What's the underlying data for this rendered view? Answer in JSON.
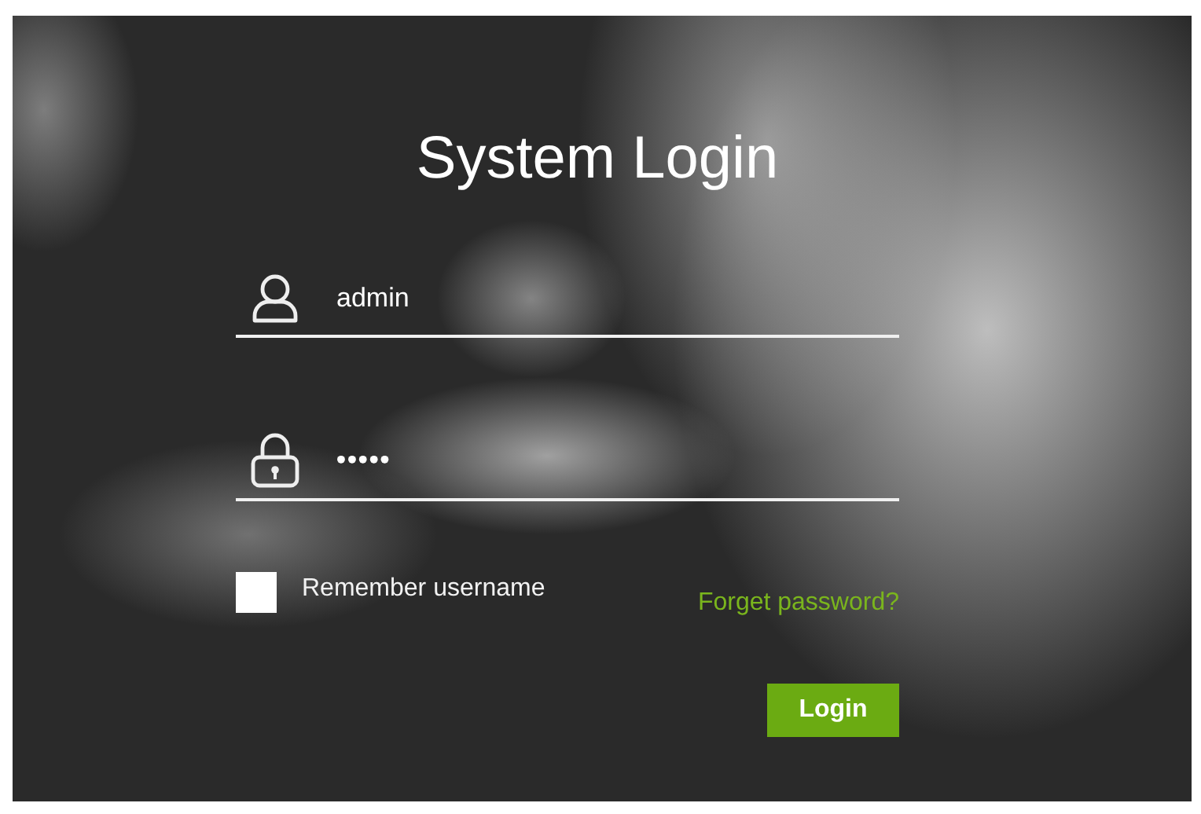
{
  "title": "System Login",
  "username": {
    "value": "admin"
  },
  "password": {
    "value": "•••••"
  },
  "remember": {
    "label": "Remember username",
    "checked": false
  },
  "forgot_link": "Forget password?",
  "login_button": "Login"
}
